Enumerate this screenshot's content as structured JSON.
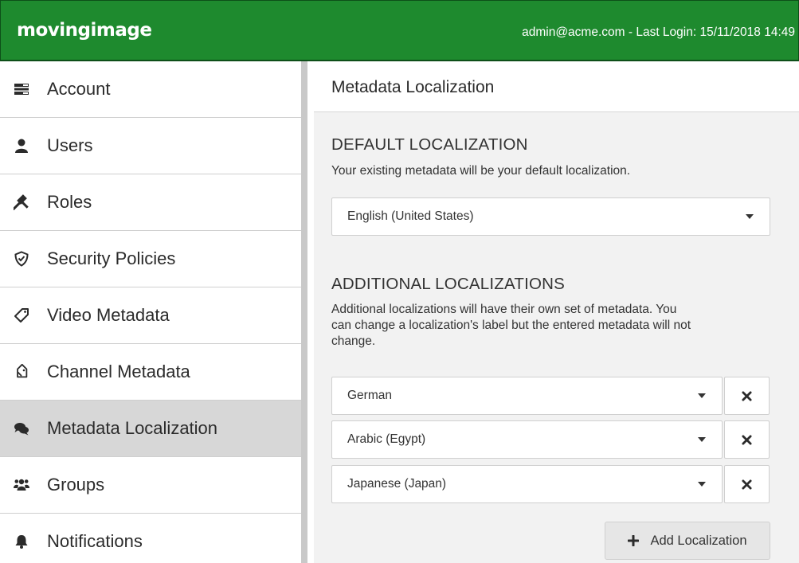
{
  "header": {
    "logo": "movingimage",
    "login_info": "admin@acme.com - Last Login: 15/11/2018 14:49"
  },
  "sidebar": {
    "items": [
      {
        "label": "Account",
        "icon": "account-icon"
      },
      {
        "label": "Users",
        "icon": "user-icon"
      },
      {
        "label": "Roles",
        "icon": "gavel-icon"
      },
      {
        "label": "Security Policies",
        "icon": "shield-icon"
      },
      {
        "label": "Video Metadata",
        "icon": "tag-icon"
      },
      {
        "label": "Channel Metadata",
        "icon": "tags-icon"
      },
      {
        "label": "Metadata Localization",
        "icon": "comments-icon",
        "active": true
      },
      {
        "label": "Groups",
        "icon": "users-group-icon"
      },
      {
        "label": "Notifications",
        "icon": "bell-icon"
      }
    ]
  },
  "main": {
    "title": "Metadata Localization",
    "default_section": {
      "heading": "DEFAULT LOCALIZATION",
      "description": "Your existing metadata will be your default localization.",
      "selected": "English (United States)"
    },
    "additional_section": {
      "heading": "ADDITIONAL LOCALIZATIONS",
      "description_line1": "Additional localizations will have their own set of metadata. You",
      "description_line2": "can change a localization's label but the entered metadata will not",
      "description_line3": "change.",
      "localizations": [
        {
          "selected": "German"
        },
        {
          "selected": "Arabic (Egypt)"
        },
        {
          "selected": "Japanese (Japan)"
        }
      ]
    },
    "add_button_label": "Add Localization"
  },
  "colors": {
    "brand_green": "#1e8a2e",
    "active_item_bg": "#d7d7d7",
    "content_bg": "#f2f2f2"
  }
}
